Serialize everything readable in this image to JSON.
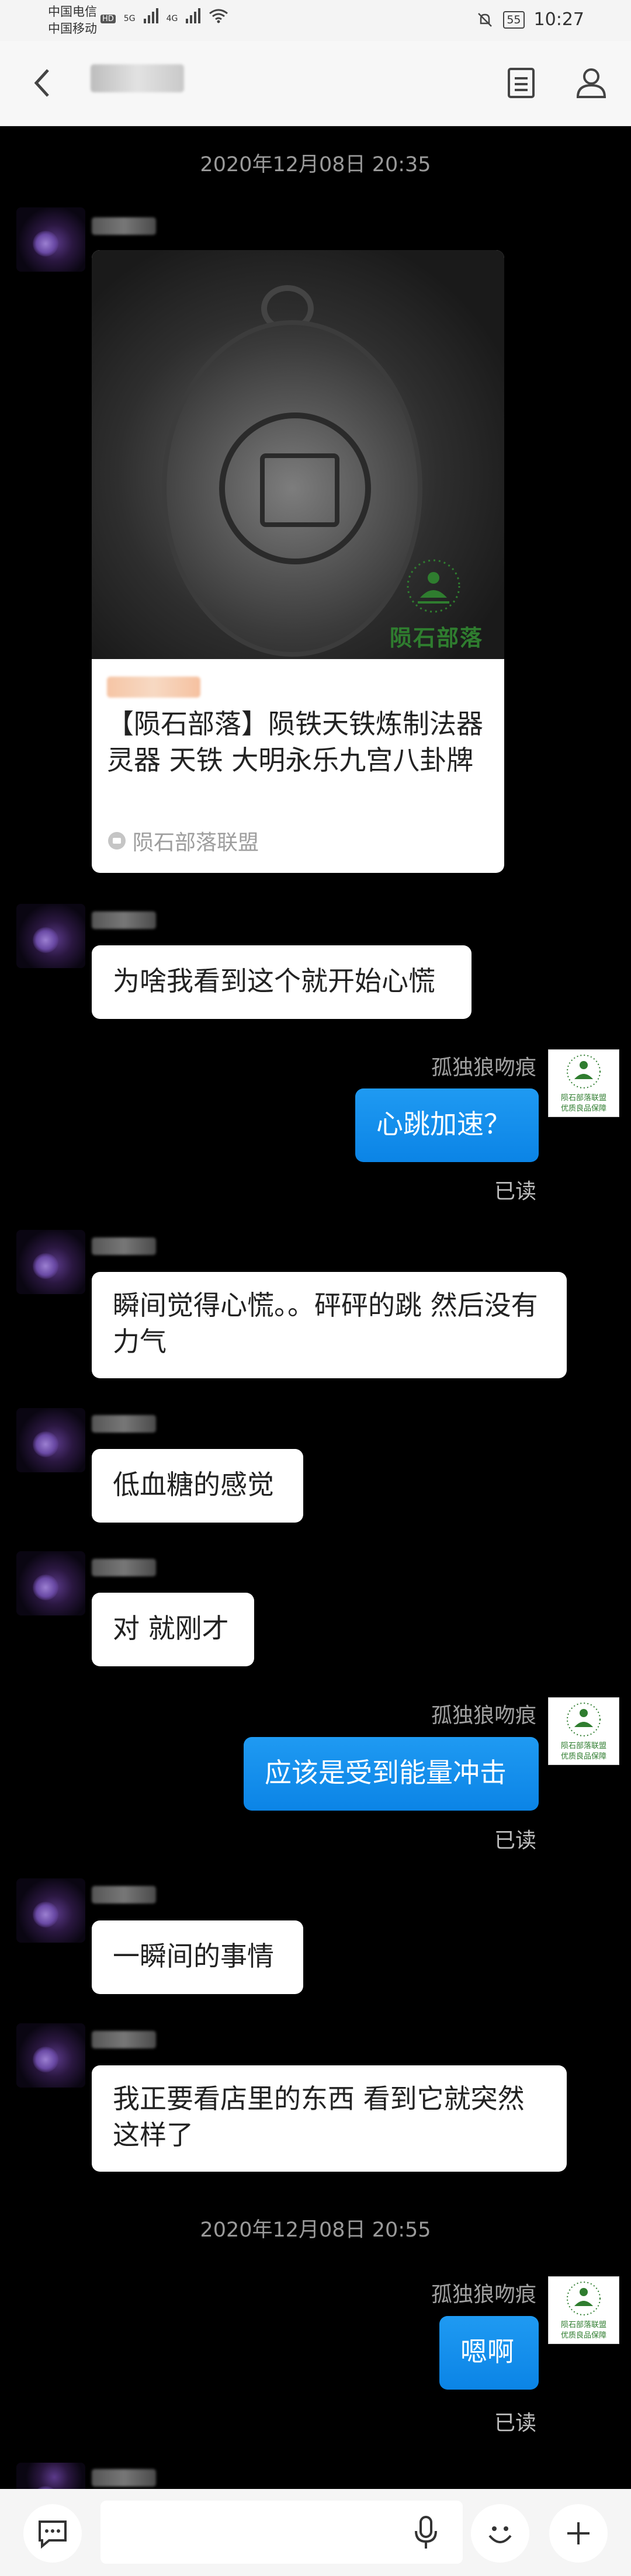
{
  "status_bar": {
    "carrier1": "中国电信",
    "carrier2": "中国移动",
    "hd": "HD",
    "net1": "5G",
    "net2": "4G",
    "battery": "55",
    "time": "10:27"
  },
  "nav": {
    "back_icon": "chevron-left-icon",
    "doc_icon": "document-icon",
    "profile_icon": "person-icon"
  },
  "messages": {
    "ts1": "2020年12月08日 20:35",
    "card_title": "【陨石部落】陨铁天铁炼制法器灵器 天铁 大明永乐九宫八卦牌",
    "card_source": "陨石部落联盟",
    "card_badge": "陨石部落",
    "m1": "为啥我看到这个就开始心慌",
    "me_name": "孤独狼吻痕",
    "m2": "心跳加速？",
    "read": "已读",
    "m3": "瞬间觉得心慌。。砰砰的跳 然后没有力气",
    "m4": "低血糖的感觉",
    "m5": "对 就刚才",
    "m6": "应该是受到能量冲击",
    "m7": "一瞬间的事情",
    "m8": "我正要看店里的东西 看到它就突然这样了",
    "ts2": "2020年12月08日 20:55",
    "m9": "嗯啊",
    "my_avatar_line1": "陨石部落联盟",
    "my_avatar_line2": "优质良品保障"
  },
  "input_bar": {
    "chat_icon": "chat-icon",
    "mic_icon": "microphone-icon",
    "emoji_icon": "smile-icon",
    "plus_icon": "plus-icon"
  }
}
